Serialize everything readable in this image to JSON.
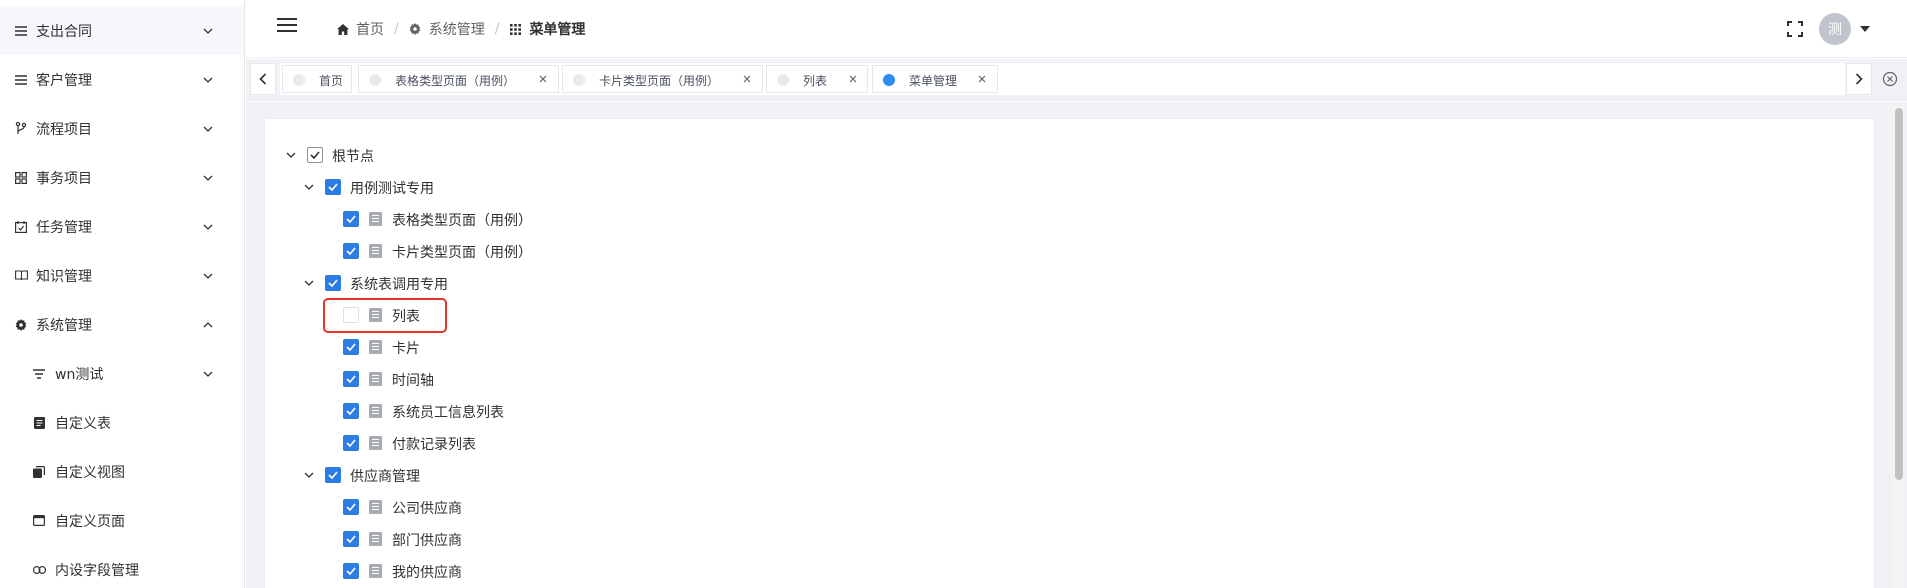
{
  "sidebar": {
    "items": [
      {
        "label": "支出合同",
        "icon": "list-icon",
        "expanded": false
      },
      {
        "label": "客户管理",
        "icon": "list-icon",
        "expanded": false
      },
      {
        "label": "流程项目",
        "icon": "branch-icon",
        "expanded": false
      },
      {
        "label": "事务项目",
        "icon": "grid-icon",
        "expanded": false
      },
      {
        "label": "任务管理",
        "icon": "calendar-check-icon",
        "expanded": false
      },
      {
        "label": "知识管理",
        "icon": "book-icon",
        "expanded": false
      },
      {
        "label": "系统管理",
        "icon": "gear-icon",
        "expanded": true
      }
    ],
    "subitems": [
      {
        "label": "wn测试",
        "icon": "filter-icon",
        "has_children": true
      },
      {
        "label": "自定义表",
        "icon": "table-doc-icon",
        "has_children": false
      },
      {
        "label": "自定义视图",
        "icon": "copy-icon",
        "has_children": false
      },
      {
        "label": "自定义页面",
        "icon": "window-icon",
        "has_children": false
      },
      {
        "label": "内设字段管理",
        "icon": "link-icon",
        "has_children": false
      }
    ]
  },
  "header": {
    "breadcrumb": [
      {
        "label": "首页",
        "icon": "home-icon"
      },
      {
        "label": "系统管理",
        "icon": "gear-icon"
      },
      {
        "label": "菜单管理",
        "icon": "grid-dots-icon"
      }
    ],
    "separator": "/",
    "avatar_text": "测"
  },
  "tabs": [
    {
      "label": "首页",
      "closable": false,
      "active": false
    },
    {
      "label": "表格类型页面（用例）",
      "closable": true,
      "active": false
    },
    {
      "label": "卡片类型页面（用例）",
      "closable": true,
      "active": false
    },
    {
      "label": "列表",
      "closable": true,
      "active": false
    },
    {
      "label": "菜单管理",
      "closable": true,
      "active": true
    }
  ],
  "tree": {
    "nodes": [
      {
        "label": "根节点",
        "level": 0,
        "expandable": true,
        "checked": true
      },
      {
        "label": "用例测试专用",
        "level": 1,
        "expandable": true,
        "checked": true
      },
      {
        "label": "表格类型页面（用例）",
        "level": 2,
        "expandable": false,
        "checked": true
      },
      {
        "label": "卡片类型页面（用例）",
        "level": 2,
        "expandable": false,
        "checked": true
      },
      {
        "label": "系统表调用专用",
        "level": 1,
        "expandable": true,
        "checked": true
      },
      {
        "label": "列表",
        "level": 2,
        "expandable": false,
        "checked": false
      },
      {
        "label": "卡片",
        "level": 2,
        "expandable": false,
        "checked": true
      },
      {
        "label": "时间轴",
        "level": 2,
        "expandable": false,
        "checked": true
      },
      {
        "label": "系统员工信息列表",
        "level": 2,
        "expandable": false,
        "checked": true
      },
      {
        "label": "付款记录列表",
        "level": 2,
        "expandable": false,
        "checked": true
      },
      {
        "label": "供应商管理",
        "level": 1,
        "expandable": true,
        "checked": true
      },
      {
        "label": "公司供应商",
        "level": 2,
        "expandable": false,
        "checked": true
      },
      {
        "label": "部门供应商",
        "level": 2,
        "expandable": false,
        "checked": true
      },
      {
        "label": "我的供应商",
        "level": 2,
        "expandable": false,
        "checked": true
      }
    ]
  },
  "colors": {
    "accent": "#2d7be5",
    "active_tab_dot": "#2d8cf0",
    "highlight": "#e6332a"
  }
}
